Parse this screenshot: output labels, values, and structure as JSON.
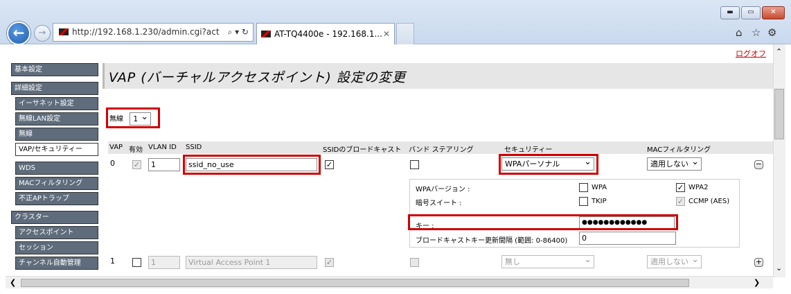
{
  "browser": {
    "address": "http://192.168.1.230/admin.cgi?act",
    "address_controls": "⌕ ▾ ↻",
    "tab_title": "AT-TQ4400e - 192.168.1...",
    "tab_close": "✕",
    "win_min": "▬",
    "win_max": "▭",
    "win_close": "✕",
    "back": "←",
    "fwd": "→",
    "home": "⌂",
    "star": "☆",
    "gear": "⚙"
  },
  "header": {
    "logout": "ログオフ",
    "title": "VAP (バーチャルアクセスポイント) 設定の変更"
  },
  "sidebar": {
    "items": [
      "基本設定",
      "詳細設定",
      "イーサネット設定",
      "無線LAN設定",
      "無線",
      "VAP/セキュリティー",
      "WDS",
      "MACフィルタリング",
      "不正APトラップ",
      "クラスター",
      "アクセスポイント",
      "セッション",
      "チャンネル自動管理"
    ]
  },
  "radio": {
    "label": "無線",
    "value": "1"
  },
  "columns": {
    "vap": "VAP",
    "enabled": "有効",
    "vlan": "VLAN ID",
    "ssid": "SSID",
    "broadcast": "SSIDのブロードキャスト",
    "band": "バンド ステアリング",
    "security": "セキュリティー",
    "mac": "MACフィルタリング"
  },
  "rows": [
    {
      "vap": "0",
      "vlan": "1",
      "ssid": "ssid_no_use",
      "security": "WPAパーソナル",
      "mac": "適用しない",
      "button": "−"
    },
    {
      "vap": "1",
      "vlan": "1",
      "ssid": "Virtual Access Point 1",
      "security": "無し",
      "mac": "適用しない",
      "button": "+"
    }
  ],
  "security_panel": {
    "version_label": "WPAバージョン :",
    "wpa": "WPA",
    "wpa2": "WPA2",
    "cipher_label": "暗号スイート :",
    "tkip": "TKIP",
    "ccmp": "CCMP (AES)",
    "key_label": "キー :",
    "key_value": "●●●●●●●●●●●●",
    "rekey_label": "ブロードキャストキー更新間隔 (範囲: 0-86400)",
    "rekey_value": "0"
  },
  "scroll": {
    "up": "⌃",
    "down": "⌄",
    "left": "❮",
    "right": "❯"
  }
}
